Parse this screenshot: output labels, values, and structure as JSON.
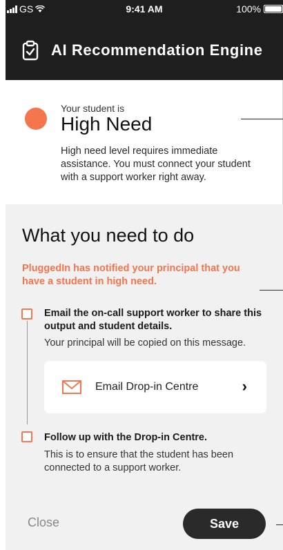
{
  "status_bar": {
    "carrier": "GS",
    "time": "9:41 AM",
    "battery": "100%"
  },
  "header": {
    "title": "AI Recommendation Engine",
    "icon": "clipboard-check-icon"
  },
  "assessment": {
    "label": "Your student is",
    "level": "High Need",
    "description": "High need level requires immediate assistance. You must connect your student with a support worker right away.",
    "indicator_color": "#f4754e"
  },
  "actions": {
    "title": "What you need to do",
    "notice": "PluggedIn has notified your principal that you have a student in high need.",
    "accent_color": "#f4754e",
    "tasks": [
      {
        "title": "Email the on-call support worker to share this output and student details.",
        "subtitle": "Your principal will be copied on this message.",
        "checked": false
      },
      {
        "title": "Follow up with the Drop-in Centre.",
        "subtitle": "This is to ensure that the student has been connected to a support worker.",
        "checked": false
      }
    ],
    "email_card": {
      "label": "Email Drop-in Centre",
      "icon": "mail-icon",
      "chevron": "›"
    }
  },
  "footer": {
    "close_label": "Close",
    "save_label": "Save"
  }
}
